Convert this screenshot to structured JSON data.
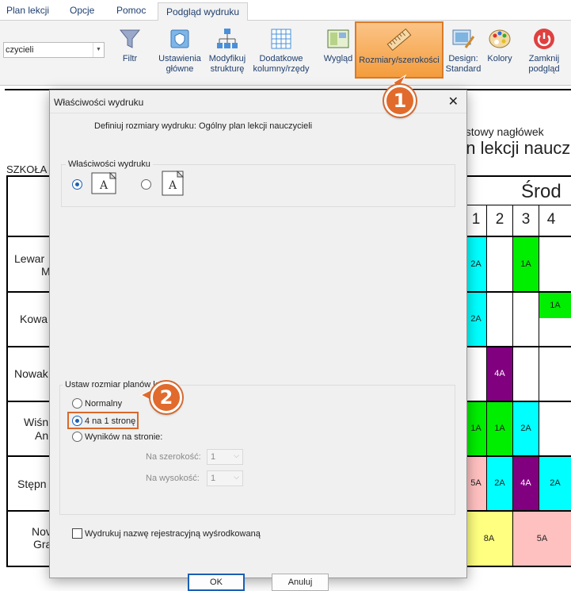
{
  "tabs": [
    "Plan lekcji",
    "Opcje",
    "Pomoc",
    "Podgląd wydruku"
  ],
  "combo_value": "czycieli",
  "ribbon": {
    "filtr": "Filtr",
    "ustawienia": [
      "Ustawienia",
      "główne"
    ],
    "modyfikuj": [
      "Modyfikuj",
      "strukturę"
    ],
    "dodatkowe": [
      "Dodatkowe",
      "kolumny/rzędy"
    ],
    "wyglad": "Wygląd",
    "rozmiary": "Rozmiary/szerokości",
    "design": [
      "Design:",
      "Standard"
    ],
    "kolory": "Kolory",
    "zamknij": [
      "Zamknij",
      "podgląd"
    ]
  },
  "badges": [
    "1",
    "2"
  ],
  "background": {
    "header_small": "estowy nagłówek",
    "header_big": "an lekcji naucz",
    "school": "SZKOŁA",
    "day": "Środ",
    "periods": [
      "1",
      "2",
      "3",
      "4"
    ],
    "teachers": [
      [
        "Lewar",
        "M"
      ],
      [
        "Kowa"
      ],
      [
        "Nowak"
      ],
      [
        "Wiśn",
        "An"
      ],
      [
        "Stępn"
      ],
      [
        "Nov",
        "Gra"
      ]
    ],
    "lessons": [
      "2A",
      "1A",
      "2A",
      "1A",
      "4A",
      "1A",
      "1A",
      "2A",
      "5A",
      "2A",
      "4A",
      "2A",
      "8A",
      "5A"
    ]
  },
  "dialog": {
    "title": "Właściwości wydruku",
    "subtitle": "Definiuj rozmiary wydruku: Ogólny plan lekcji nauczycieli",
    "props_legend": "Właściwości wydruku",
    "size_legend": "Ustaw rozmiar planów lekcji",
    "options": [
      "Normalny",
      "4 na 1 stronę",
      "Wyników na stronie:"
    ],
    "width_label": "Na szerokość:",
    "height_label": "Na wysokość:",
    "width_value": "1",
    "height_value": "1",
    "checkbox_label": "Wydrukuj nazwę rejestracyjną wyśrodkowaną",
    "ok": "OK",
    "cancel": "Anuluj"
  },
  "colors": {
    "cyan": "#00ffff",
    "green": "#00ee00",
    "purple": "#800080",
    "pink": "#ffc0c0",
    "yellow": "#ffff80",
    "orange": "#f49c3c"
  }
}
